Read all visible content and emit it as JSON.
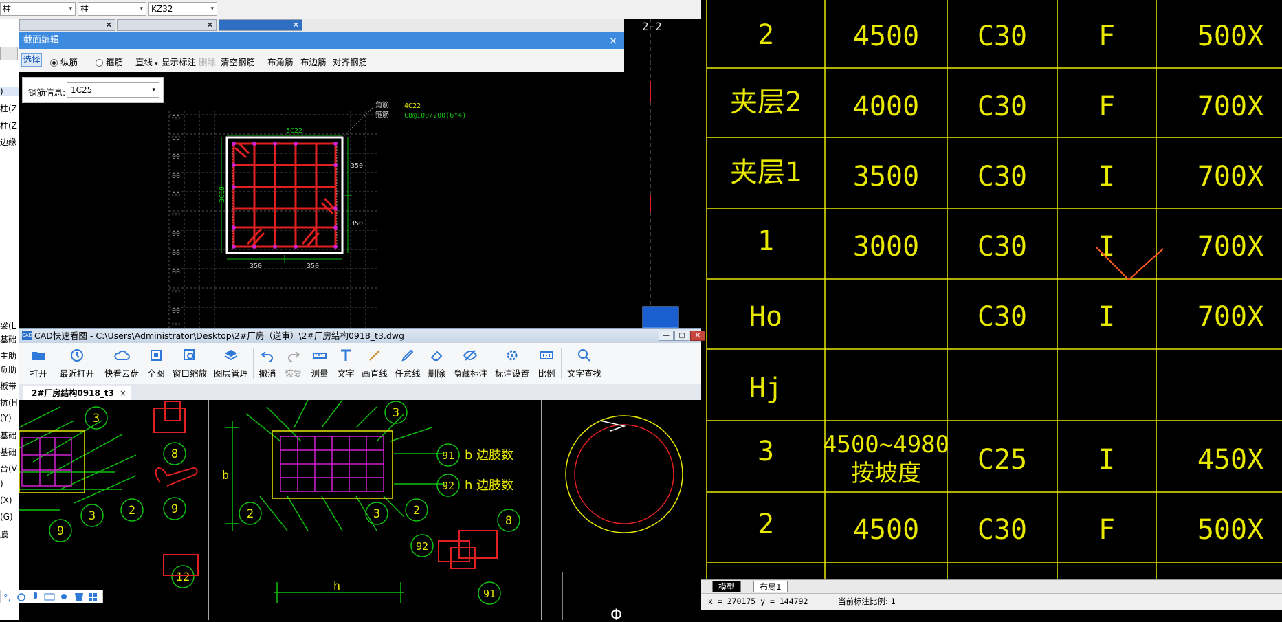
{
  "top_combos": [
    "柱",
    "柱",
    "KZ32"
  ],
  "left_panel_items": [
    ")",
    "柱(Z",
    "柱(Z",
    "边缘",
    "梁(L",
    "基础",
    "主肋",
    "负肋",
    "板带",
    "抗(H",
    "(Y)",
    "基础",
    "基础",
    "台(V",
    ")",
    "(X)",
    "(G)",
    "膜"
  ],
  "section_editor": {
    "title": "截面编辑",
    "close_glyph": "×",
    "toolbar": {
      "select": "选择",
      "longitudinal": "纵筋",
      "stirrup": "箍筋",
      "line": "直线",
      "show_dims": "显示标注",
      "delete": "删除",
      "clear_rebar": "清空钢筋",
      "corner_rebar": "布角筋",
      "edge_rebar": "布边筋",
      "align_rebar": "对齐钢筋"
    },
    "rebar_info_label": "钢筋信息:",
    "rebar_info_value": "1C25",
    "drawing": {
      "corner_label": "角筋",
      "stirrup_label": "箍筋",
      "corner_value": "4C22",
      "stirrup_value": "C8@100/200(6*4)",
      "top_label": "5C22",
      "side_label": "3C18",
      "dim_right_top": "350",
      "dim_right_bottom": "350",
      "dim_bottom_left": "350",
      "dim_bottom_right": "350",
      "grid_labels": [
        "00",
        "00",
        "00",
        "00",
        "00",
        "00",
        "00",
        "00",
        "00",
        "00",
        "00",
        "00"
      ]
    }
  },
  "cad_viewer": {
    "title": "CAD快速看图 - C:\\Users\\Administrator\\Desktop\\2#厂房（送审）\\2#厂房结构0918_t3.dwg",
    "logo": "CAD",
    "window_buttons": [
      "—",
      "▢",
      "✕"
    ],
    "toolbar": [
      "打开",
      "最近打开",
      "快看云盘",
      "全图",
      "窗口缩放",
      "图层管理",
      "撤消",
      "恢复",
      "测量",
      "文字",
      "画直线",
      "任意线",
      "删除",
      "隐藏标注",
      "标注设置",
      "比例",
      "文字查找"
    ],
    "doc_tab": "2#厂房结构0918_t3",
    "doc_tab_close": "×",
    "drawing": {
      "circles_left": [
        "3",
        "3",
        "2",
        "9"
      ],
      "circles_mid": [
        "8",
        "9",
        "12"
      ],
      "circles_right": [
        "3",
        "2",
        "3",
        "2",
        "91",
        "92",
        "8",
        "92",
        "91"
      ],
      "label_b": "b 边肢数",
      "label_h": "h 边肢数",
      "dim_b": "b",
      "dim_h": "h",
      "phi": "Φ"
    }
  },
  "right_cad": {
    "label_22": "2-2",
    "rows": [
      {
        "floor": "2",
        "height": "4500",
        "grade": "C30",
        "type": "F",
        "size": "500X"
      },
      {
        "floor": "夹层2",
        "height": "4000",
        "grade": "C30",
        "type": "F",
        "size": "700X"
      },
      {
        "floor": "夹层1",
        "height": "3500",
        "grade": "C30",
        "type": "I",
        "size": "700X"
      },
      {
        "floor": "1",
        "height": "3000",
        "grade": "C30",
        "type": "I",
        "size": "700X"
      },
      {
        "floor": "Ho",
        "height": "",
        "grade": "C30",
        "type": "I",
        "size": "700X"
      },
      {
        "floor": "Hj",
        "height": "",
        "grade": "",
        "type": "",
        "size": ""
      },
      {
        "floor": "3",
        "height": "4500~4980",
        "height2": "按坡度",
        "grade": "C25",
        "type": "I",
        "size": "450X"
      },
      {
        "floor": "2",
        "height": "4500",
        "grade": "C30",
        "type": "F",
        "size": "500X"
      }
    ],
    "tabs": [
      "模型",
      "布局1"
    ],
    "status": "x = 270175  y = 144792",
    "status_scale": "当前标注比例: 1"
  },
  "colors": {
    "cad_yellow": "#e8e800",
    "rebar_red": "#e02020",
    "green": "#10c010",
    "magenta": "#d020d0",
    "title_blue": "#3d8be0"
  }
}
